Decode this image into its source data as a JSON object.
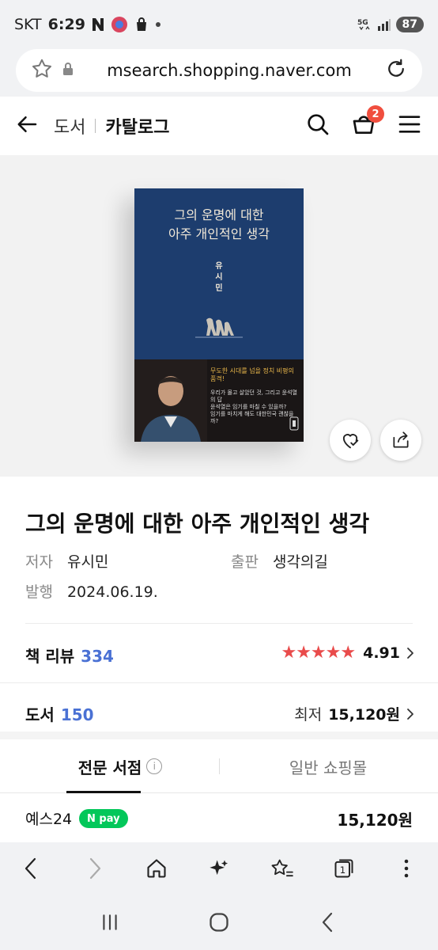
{
  "status_bar": {
    "carrier": "SKT",
    "time": "6:29",
    "battery": "87",
    "network": "5G"
  },
  "url_bar": {
    "url": "msearch.shopping.naver.com"
  },
  "header": {
    "breadcrumb_category": "도서",
    "breadcrumb_page": "카탈로그",
    "cart_count": "2"
  },
  "book": {
    "cover_title_line1": "그의 운명에 대한",
    "cover_title_line2": "아주 개인적인 생각",
    "cover_author_line1": "유",
    "cover_author_line2": "시",
    "cover_author_line3": "민",
    "cover_slogan": "무도한 시대를 넘을 정치 비평의 품격!",
    "cover_blurb_line1": "우리가 몰고 살았던 것, 그리고 윤석열의 답",
    "cover_blurb_line2": "윤석열은 임기를 마칠 수 있을까?",
    "cover_blurb_line3": "임기를 마치게 해도 대한민국 괜찮을까?"
  },
  "product": {
    "title": "그의 운명에 대한 아주 개인적인 생각",
    "author_label": "저자",
    "author": "유시민",
    "publisher_label": "출판",
    "publisher": "생각의길",
    "date_label": "발행",
    "date": "2024.06.19."
  },
  "review": {
    "label": "책 리뷰",
    "count": "334",
    "stars": "★★★★★",
    "rating": "4.91"
  },
  "price_summary": {
    "label": "도서",
    "count": "150",
    "lowest_label": "최저",
    "lowest_price": "15,120원"
  },
  "tabs": [
    {
      "label": "전문 서점",
      "active": true
    },
    {
      "label": "일반 쇼핑몰",
      "active": false
    }
  ],
  "shops": [
    {
      "name": "예스24",
      "badge": "N pay",
      "price": "15,120원"
    }
  ],
  "colors": {
    "accent_blue": "#4a71d4",
    "star_red": "#e94b4b",
    "badge_red": "#f04e3e",
    "npay_green": "#03c75a",
    "book_cover": "#1d3d6e"
  },
  "icons": {
    "back": "arrow-left-icon",
    "search": "search-icon",
    "cart": "cart-icon",
    "menu": "hamburger-menu-icon",
    "favorite": "heart-check-icon",
    "share": "share-icon"
  }
}
